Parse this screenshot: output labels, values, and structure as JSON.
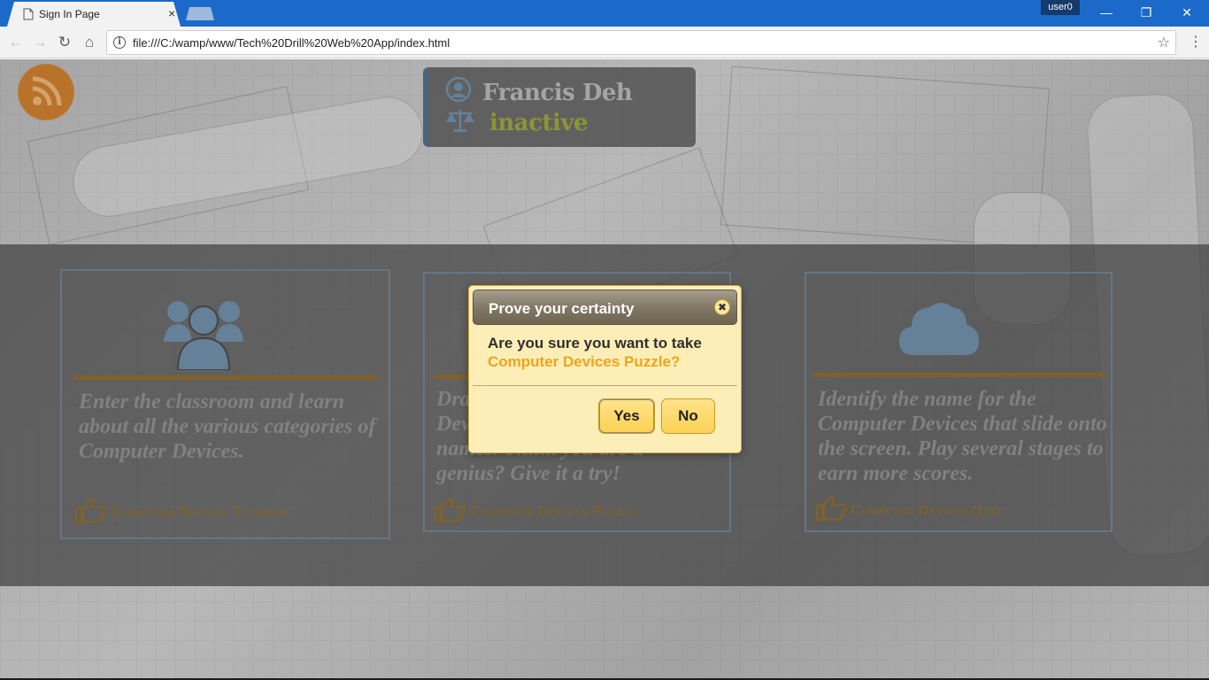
{
  "browser": {
    "tab_title": "Sign In Page",
    "tab_close": "×",
    "user_badge": "user0",
    "url": "file:///C:/wamp/www/Tech%20Drill%20Web%20App/index.html",
    "window_controls": {
      "minimize": "—",
      "maximize": "❐",
      "close": "✕"
    }
  },
  "profile": {
    "name": "Francis Deh",
    "status": "inactive"
  },
  "cards": [
    {
      "text": "Enter the classroom and learn about all the various categories of Computer Devices.",
      "link": "Computer Devices Tutorial",
      "icon": "users-icon"
    },
    {
      "text": "Drag the Computer Devices to match their names. Think you are a genius? Give it a try!",
      "visible_text_lines": [
        "Dra",
        "Dev",
        "names. Think you are a",
        "genius? Give it a try!"
      ],
      "link": "Computer Devices Puzzle",
      "icon": "puzzle-icon"
    },
    {
      "text": "Identify the name for the Computer Devices that slide onto the screen. Play several stages to earn more scores.",
      "link": "Computer Devices Quiz",
      "icon": "cloud-icon"
    }
  ],
  "dialog": {
    "title": "Prove your certainty",
    "close": "✖",
    "message": "Are you sure you want to take",
    "highlight": "Computer Devices Puzzle?",
    "yes_label": "Yes",
    "no_label": "No"
  },
  "colors": {
    "titlebar": "#1b6ac9",
    "dialog_bg": "#fdeeb7",
    "accent_orange": "#f0a31a",
    "card_gold": "#8a6a2f",
    "icon_blue": "#6e8ca6"
  }
}
